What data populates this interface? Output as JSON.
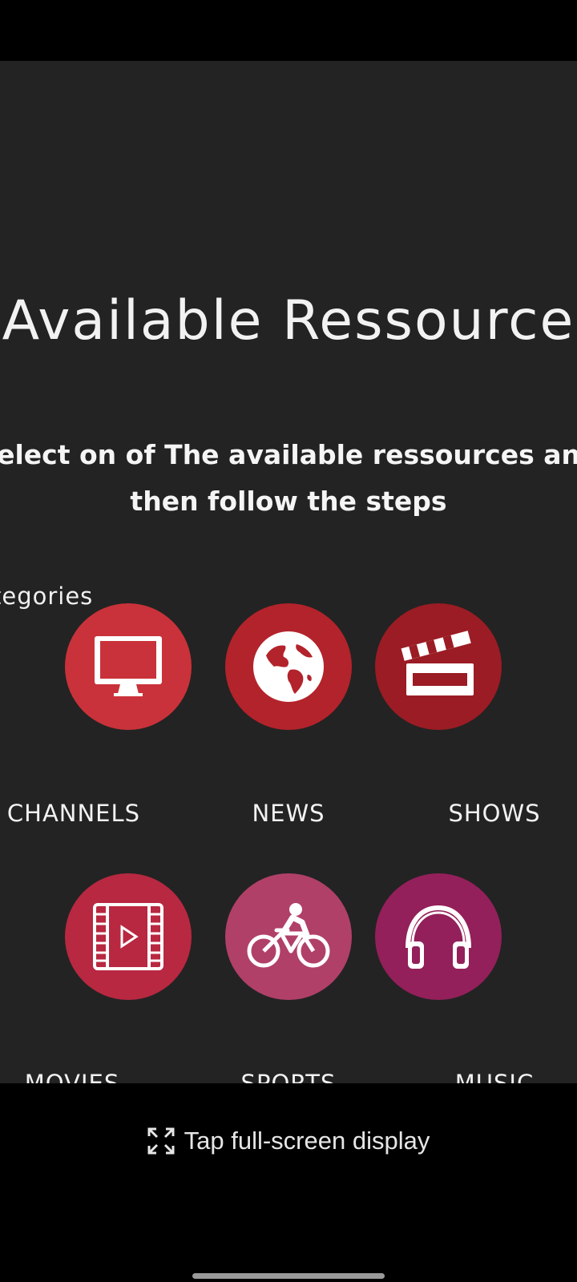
{
  "page": {
    "title": "Available Ressource",
    "subtitle": "Select on of The available ressources and\nthen follow the steps",
    "section_label": "tegories"
  },
  "categories": [
    {
      "label": "CHANNELS",
      "icon": "monitor-icon",
      "color": "#c9323a"
    },
    {
      "label": "NEWS",
      "icon": "globe-icon",
      "color": "#b3232b"
    },
    {
      "label": "SHOWS",
      "icon": "clapperboard-icon",
      "color": "#9b1c24"
    },
    {
      "label": "MOVIES",
      "icon": "film-play-icon",
      "color": "#b82841"
    },
    {
      "label": "SPORTS",
      "icon": "cyclist-icon",
      "color": "#b04068"
    },
    {
      "label": "MUSIC",
      "icon": "headphones-icon",
      "color": "#93205a"
    }
  ],
  "footer": {
    "fullscreen_label": "Tap full-screen display",
    "fullscreen_icon": "expand-icon"
  }
}
